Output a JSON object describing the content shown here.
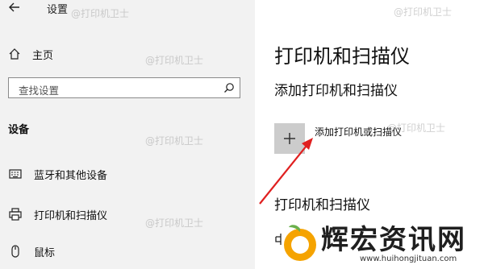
{
  "window": {
    "title": "设置"
  },
  "sidebar": {
    "home_label": "主页",
    "search_placeholder": "查找设置",
    "section_label": "设备",
    "items": [
      {
        "label": "蓝牙和其他设备",
        "icon": "keyboard-icon"
      },
      {
        "label": "打印机和扫描仪",
        "icon": "printer-icon"
      },
      {
        "label": "鼠标",
        "icon": "mouse-icon"
      }
    ]
  },
  "main": {
    "title": "打印机和扫描仪",
    "add_section_title": "添加打印机和扫描仪",
    "add_button_label": "添加打印机或扫描仪",
    "list_section_title": "打印机和扫描仪"
  },
  "watermarks": [
    "@打印机卫士",
    "@打印机卫士",
    "@打印机卫士",
    "@打印机卫士",
    "@打印机卫士",
    "@打印机卫士"
  ],
  "brand": {
    "name": "辉宏资讯网",
    "url": "www.huihongjituan.com"
  },
  "colors": {
    "sidebar_bg": "#f2f2f2",
    "add_button_bg": "#cccccc",
    "arrow": "#e02020",
    "logo_orange": "#f5a300",
    "logo_green": "#6ab04c"
  }
}
